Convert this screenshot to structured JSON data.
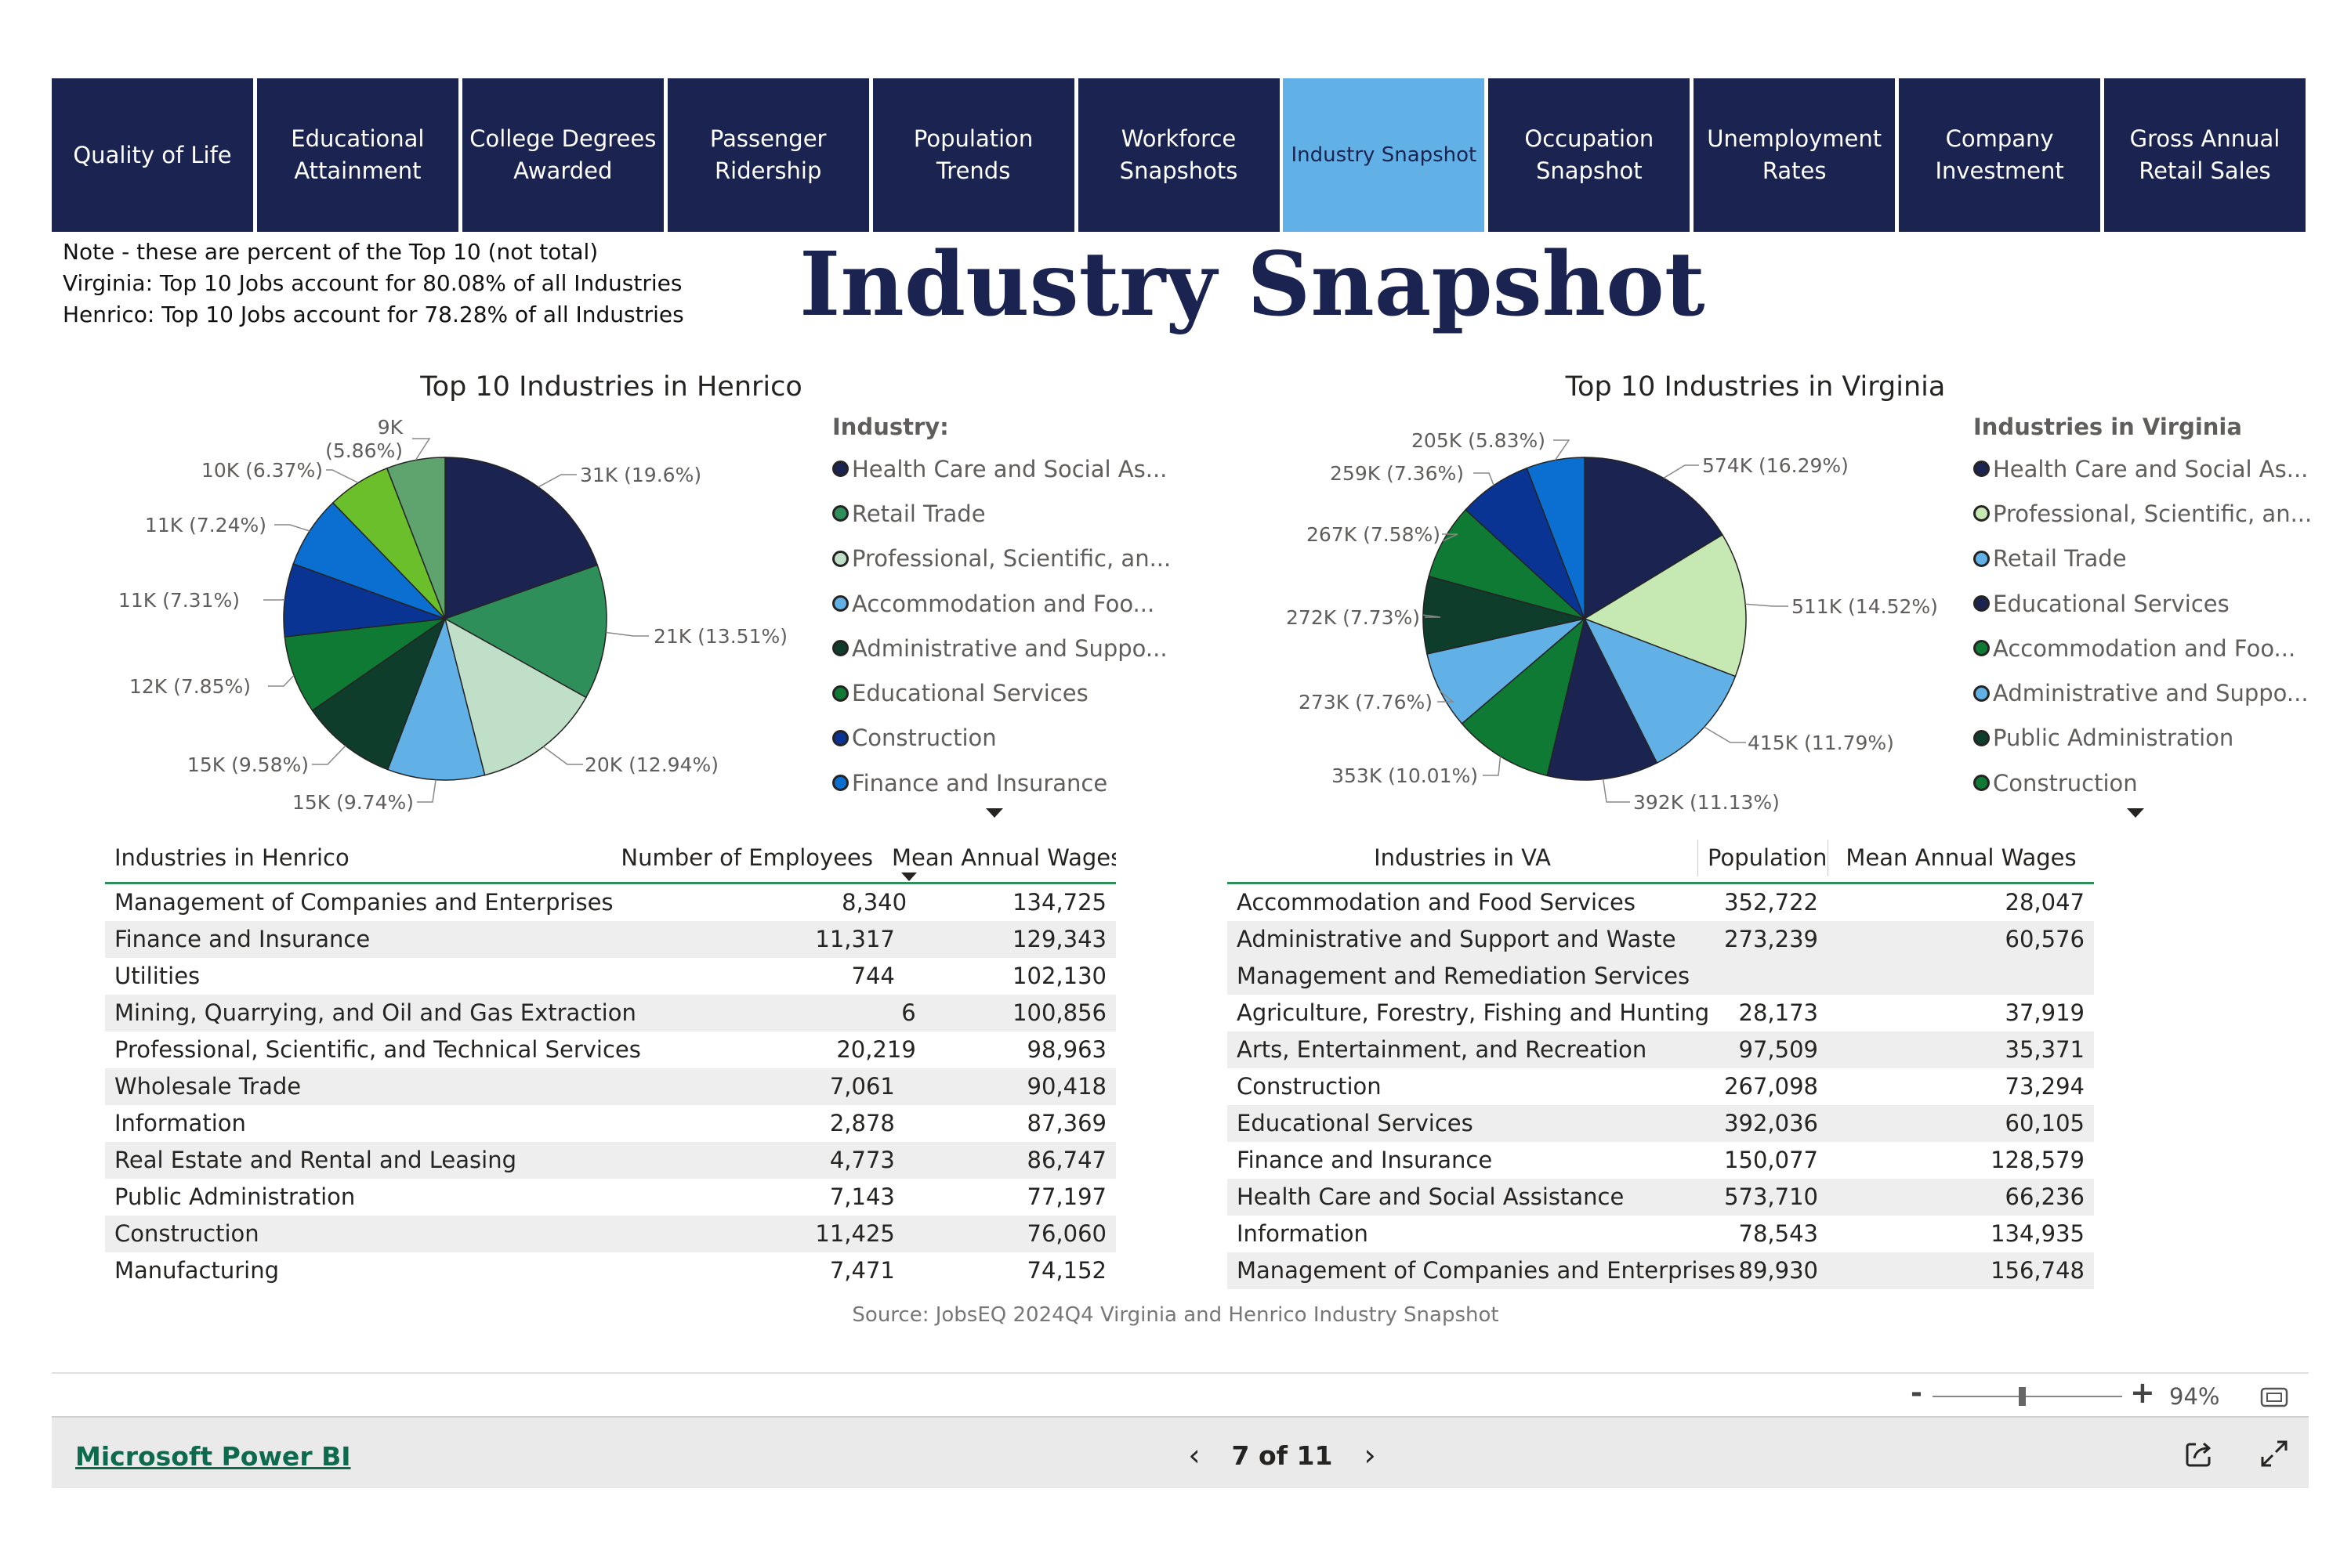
{
  "nav": {
    "tabs": [
      "Quality of Life",
      "Educational Attainment",
      "College Degrees Awarded",
      "Passenger Ridership",
      "Population Trends",
      "Workforce Snapshots",
      "Industry Snapshot",
      "Occupation Snapshot",
      "Unemployment Rates",
      "Company Investment",
      "Gross Annual Retail Sales"
    ],
    "active_tab": "Industry Snapshot"
  },
  "notes": [
    "Note - these are percent of the Top 10 (not total)",
    "Virginia: Top 10 Jobs account for 80.08% of all Industries",
    "Henrico: Top 10 Jobs account for 78.28% of all Industries"
  ],
  "page_title": "Industry Snapshot",
  "henrico_pie": {
    "legend_title": "Industry:",
    "legend_items": [
      {
        "label": "Health Care and Social As...",
        "color": "#1b2451"
      },
      {
        "label": "Retail Trade",
        "color": "#2f8f5a"
      },
      {
        "label": "Professional, Scientific, an...",
        "color": "#c0dfc8"
      },
      {
        "label": "Accommodation and Foo...",
        "color": "#62b1e6"
      },
      {
        "label": "Administrative and Suppo...",
        "color": "#0f3d2c"
      },
      {
        "label": "Educational Services",
        "color": "#0f7a34"
      },
      {
        "label": "Construction",
        "color": "#0a3494"
      },
      {
        "label": "Finance and Insurance",
        "color": "#0a6fd1"
      }
    ]
  },
  "virginia_pie": {
    "legend_title": "Industries in Virginia",
    "legend_items": [
      {
        "label": "Health Care and Social As...",
        "color": "#1b2451"
      },
      {
        "label": "Professional, Scientific, an...",
        "color": "#c6e8b3"
      },
      {
        "label": "Retail Trade",
        "color": "#62b1e6"
      },
      {
        "label": "Educational Services",
        "color": "#1b2451"
      },
      {
        "label": "Accommodation and Foo...",
        "color": "#0f7a34"
      },
      {
        "label": "Administrative and Suppo...",
        "color": "#62b1e6"
      },
      {
        "label": "Public Administration",
        "color": "#0f3d2c"
      },
      {
        "label": "Construction",
        "color": "#0f7a34"
      }
    ]
  },
  "chart_data": [
    {
      "type": "pie",
      "title": "Top 10 Industries in Henrico",
      "slices": [
        {
          "label": "31K (19.6%)",
          "value": 19.6,
          "color": "#1b2451"
        },
        {
          "label": "21K (13.51%)",
          "value": 13.51,
          "color": "#2f8f5a"
        },
        {
          "label": "20K (12.94%)",
          "value": 12.94,
          "color": "#c0dfc8"
        },
        {
          "label": "15K (9.74%)",
          "value": 9.74,
          "color": "#62b1e6"
        },
        {
          "label": "15K (9.58%)",
          "value": 9.58,
          "color": "#0f3d2c"
        },
        {
          "label": "12K (7.85%)",
          "value": 7.85,
          "color": "#0f7a34"
        },
        {
          "label": "11K (7.31%)",
          "value": 7.31,
          "color": "#0a3494"
        },
        {
          "label": "11K (7.24%)",
          "value": 7.24,
          "color": "#0a6fd1"
        },
        {
          "label": "10K (6.37%)",
          "value": 6.37,
          "color": "#6bbf2a"
        },
        {
          "label": "9K (5.86%)",
          "value": 5.86,
          "color": "#5fa36f"
        }
      ]
    },
    {
      "type": "pie",
      "title": "Top 10 Industries in Virginia",
      "slices": [
        {
          "label": "574K (16.29%)",
          "value": 16.29,
          "color": "#1b2451"
        },
        {
          "label": "511K (14.52%)",
          "value": 14.52,
          "color": "#c6e8b3"
        },
        {
          "label": "415K (11.79%)",
          "value": 11.79,
          "color": "#62b1e6"
        },
        {
          "label": "392K (11.13%)",
          "value": 11.13,
          "color": "#1b2451"
        },
        {
          "label": "353K (10.01%)",
          "value": 10.01,
          "color": "#0f7a34"
        },
        {
          "label": "273K (7.76%)",
          "value": 7.76,
          "color": "#62b1e6"
        },
        {
          "label": "272K (7.73%)",
          "value": 7.73,
          "color": "#0f3d2c"
        },
        {
          "label": "267K (7.58%)",
          "value": 7.58,
          "color": "#0f7a34"
        },
        {
          "label": "259K (7.36%)",
          "value": 7.36,
          "color": "#0a3494"
        },
        {
          "label": "205K (5.83%)",
          "value": 5.83,
          "color": "#0a6fd1"
        }
      ]
    }
  ],
  "henrico_table": {
    "headers": [
      "Industries in Henrico",
      "Number of Employees",
      "Mean Annual Wages"
    ],
    "rows": [
      [
        "Management of Companies and Enterprises",
        "8,340",
        "134,725"
      ],
      [
        "Finance and Insurance",
        "11,317",
        "129,343"
      ],
      [
        "Utilities",
        "744",
        "102,130"
      ],
      [
        "Mining, Quarrying, and Oil and Gas Extraction",
        "6",
        "100,856"
      ],
      [
        "Professional, Scientific, and Technical Services",
        "20,219",
        "98,963"
      ],
      [
        "Wholesale Trade",
        "7,061",
        "90,418"
      ],
      [
        "Information",
        "2,878",
        "87,369"
      ],
      [
        "Real Estate and Rental and Leasing",
        "4,773",
        "86,747"
      ],
      [
        "Public Administration",
        "7,143",
        "77,197"
      ],
      [
        "Construction",
        "11,425",
        "76,060"
      ],
      [
        "Manufacturing",
        "7,471",
        "74,152"
      ]
    ]
  },
  "va_table": {
    "headers": [
      "Industries in VA",
      "Population",
      "Mean Annual Wages"
    ],
    "rows": [
      [
        "Accommodation and Food Services",
        "352,722",
        "28,047"
      ],
      [
        "Administrative and Support and Waste\nManagement and Remediation Services",
        "273,239",
        "60,576"
      ],
      [
        "Agriculture, Forestry, Fishing and Hunting",
        "28,173",
        "37,919"
      ],
      [
        "Arts, Entertainment, and Recreation",
        "97,509",
        "35,371"
      ],
      [
        "Construction",
        "267,098",
        "73,294"
      ],
      [
        "Educational Services",
        "392,036",
        "60,105"
      ],
      [
        "Finance and Insurance",
        "150,077",
        "128,579"
      ],
      [
        "Health Care and Social Assistance",
        "573,710",
        "66,236"
      ],
      [
        "Information",
        "78,543",
        "134,935"
      ],
      [
        "Management of Companies and Enterprises",
        "89,930",
        "156,748"
      ]
    ]
  },
  "source": "Source: JobsEQ 2024Q4 Virginia and Henrico Industry Snapshot",
  "zoom": {
    "minus": "-",
    "plus": "+",
    "value": "94%",
    "level": 0.47
  },
  "footer": {
    "brand_link": "Microsoft Power BI",
    "page_indicator": "7 of 11",
    "prev_icon": "chevron-left-icon",
    "next_icon": "chevron-right-icon",
    "share_icon": "share-icon",
    "fullscreen_icon": "expand-icon"
  }
}
